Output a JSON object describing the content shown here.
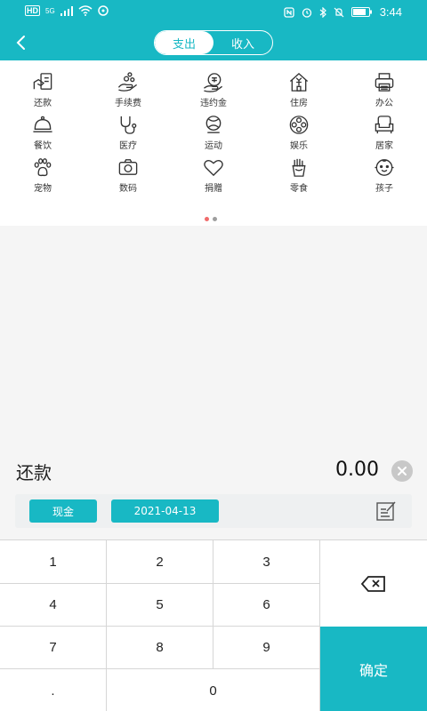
{
  "status_bar": {
    "hd": "HD",
    "network": "5G",
    "time": "3:44"
  },
  "header": {
    "tabs": [
      {
        "label": "支出",
        "active": true
      },
      {
        "label": "收入",
        "active": false
      }
    ]
  },
  "categories": [
    {
      "label": "还款",
      "icon": "repayment-icon"
    },
    {
      "label": "手续费",
      "icon": "fee-coins-hand-icon"
    },
    {
      "label": "违约金",
      "icon": "penalty-icon"
    },
    {
      "label": "住房",
      "icon": "house-icon"
    },
    {
      "label": "办公",
      "icon": "printer-icon"
    },
    {
      "label": "餐饮",
      "icon": "food-cloche-icon"
    },
    {
      "label": "医疗",
      "icon": "stethoscope-icon"
    },
    {
      "label": "运动",
      "icon": "sports-icon"
    },
    {
      "label": "娱乐",
      "icon": "film-reel-icon"
    },
    {
      "label": "居家",
      "icon": "armchair-icon"
    },
    {
      "label": "宠物",
      "icon": "paw-icon"
    },
    {
      "label": "数码",
      "icon": "camera-icon"
    },
    {
      "label": "捐赠",
      "icon": "heart-icon"
    },
    {
      "label": "零食",
      "icon": "fries-icon"
    },
    {
      "label": "孩子",
      "icon": "baby-face-icon"
    }
  ],
  "pager": {
    "pages": 2,
    "current": 1
  },
  "entry": {
    "category": "还款",
    "amount": "0.00"
  },
  "options": {
    "account": "现金",
    "date": "2021-04-13"
  },
  "keypad": {
    "keys": [
      "1",
      "2",
      "3",
      "4",
      "5",
      "6",
      "7",
      "8",
      "9",
      ".",
      "0"
    ],
    "confirm": "确定"
  },
  "colors": {
    "accent": "#18b8c4",
    "dot_active": "#f06b6b",
    "dot_inactive": "#9e9e9e"
  }
}
